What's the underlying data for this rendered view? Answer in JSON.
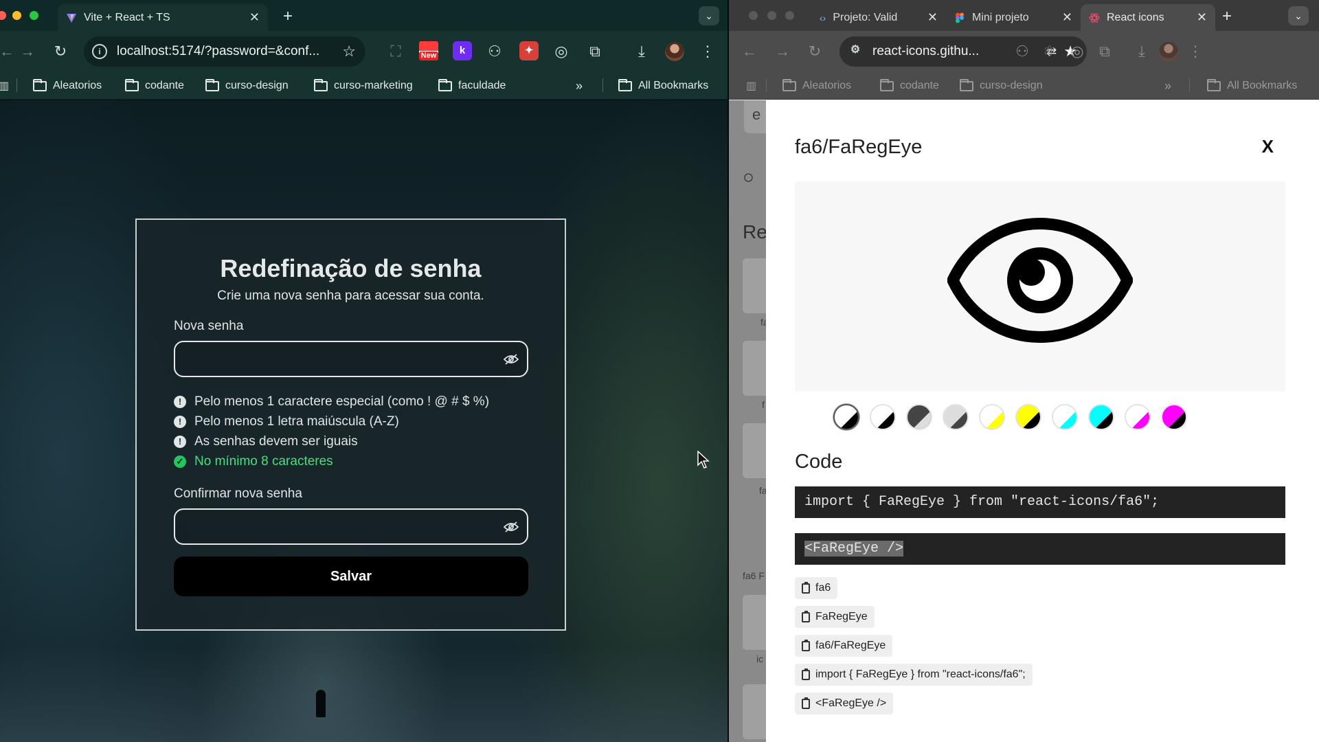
{
  "left_browser": {
    "tab_title": "Vite + React + TS",
    "url": "localhost:5174/?password=&conf...",
    "bookmarks": [
      "Aleatorios",
      "codante",
      "curso-design",
      "curso-marketing",
      "faculdade"
    ],
    "all_bookmarks": "All Bookmarks",
    "ext_new_badge": "New",
    "ext_k": "k"
  },
  "form": {
    "title": "Redefinação de senha",
    "subtitle": "Crie uma nova senha para acessar sua conta.",
    "new_password_label": "Nova senha",
    "new_password_value": "",
    "confirm_label": "Confirmar nova senha",
    "confirm_value": "",
    "requirements": [
      {
        "text": "Pelo menos 1 caractere especial (como ! @ # $ %)",
        "met": false
      },
      {
        "text": "Pelo menos 1 letra maiúscula (A-Z)",
        "met": false
      },
      {
        "text": "As senhas devem ser iguais",
        "met": false
      },
      {
        "text": "No mínimo 8 caracteres",
        "met": true
      }
    ],
    "save_label": "Salvar"
  },
  "right_browser": {
    "tabs": [
      "Projeto: Valid",
      "Mini projeto",
      "React icons"
    ],
    "url": "react-icons.githu...",
    "bookmarks": [
      "Aleatorios",
      "codante",
      "curso-design"
    ],
    "all_bookmarks": "All Bookmarks"
  },
  "background_fragments": {
    "search_letter": "e",
    "heading": "Re",
    "fa6_label": "fa6 F",
    "side_labels": [
      "fa",
      "f",
      "fa",
      "ic"
    ]
  },
  "icon_modal": {
    "title": "fa6/FaRegEye",
    "close_label": "X",
    "icon_name": "eye-icon",
    "swatches": [
      {
        "a": "#ffffff",
        "b": "#000000",
        "selected": true
      },
      {
        "a": "#ffffff",
        "b": "#000000",
        "selected": false
      },
      {
        "a": "#444444",
        "b": "#dddddd",
        "selected": false
      },
      {
        "a": "#dddddd",
        "b": "#444444",
        "selected": false
      },
      {
        "a": "#ffffff",
        "b": "#ffff00",
        "selected": false
      },
      {
        "a": "#ffff00",
        "b": "#000000",
        "selected": false
      },
      {
        "a": "#ffffff",
        "b": "#00ffff",
        "selected": false
      },
      {
        "a": "#00ffff",
        "b": "#000000",
        "selected": false
      },
      {
        "a": "#ffffff",
        "b": "#ff00ff",
        "selected": false
      },
      {
        "a": "#ff00ff",
        "b": "#000000",
        "selected": false
      }
    ],
    "code_heading": "Code",
    "import_code": "import { FaRegEye } from \"react-icons/fa6\";",
    "jsx_code": "<FaRegEye />",
    "copy_chips": [
      "fa6",
      "FaRegEye",
      "fa6/FaRegEye",
      "import { FaRegEye } from \"react-icons/fa6\";",
      "<FaRegEye />"
    ]
  },
  "colors": {
    "success": "#22c55e",
    "accent_dark": "#000000"
  }
}
